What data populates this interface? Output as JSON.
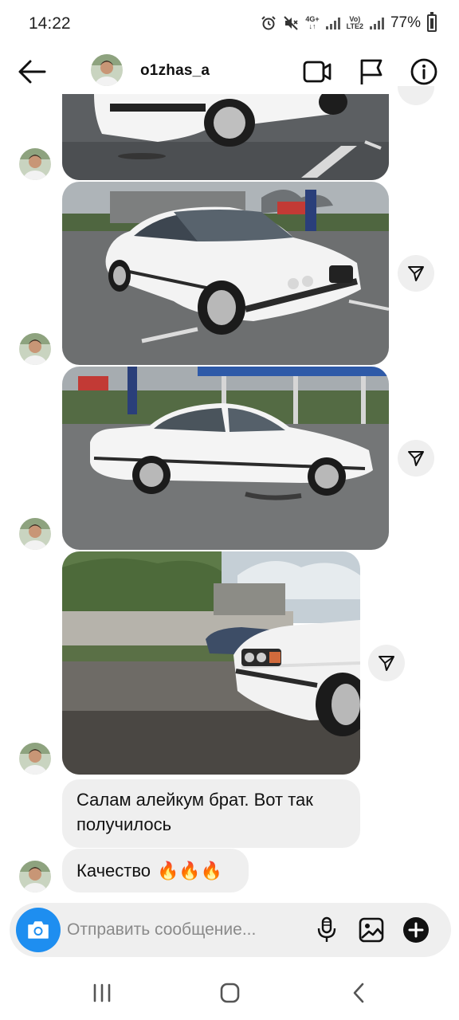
{
  "status_bar": {
    "time": "14:22",
    "network_top": "4G+",
    "volte_top": "Vo)",
    "volte_bottom": "LTE2",
    "battery": "77%"
  },
  "header": {
    "username": "o1zhas_a",
    "icons": [
      "back-arrow-icon",
      "video-call-icon",
      "flag-icon",
      "info-icon"
    ]
  },
  "messages": [
    {
      "type": "photo",
      "subject": "white sedan, partial front"
    },
    {
      "type": "photo",
      "subject": "white sedan, front three-quarter view"
    },
    {
      "type": "photo",
      "subject": "white sedan, side view"
    },
    {
      "type": "photo",
      "subject": "white sedan, front corner close-up"
    },
    {
      "type": "text",
      "text": "Салам алейкум брат. Вот так получилось"
    },
    {
      "type": "text",
      "text": "Качество",
      "emoji": "🔥🔥🔥"
    }
  ],
  "input": {
    "placeholder": "Отправить сообщение..."
  },
  "colors": {
    "accent": "#1e8ef0",
    "bubble": "#efefef",
    "text": "#111111"
  }
}
